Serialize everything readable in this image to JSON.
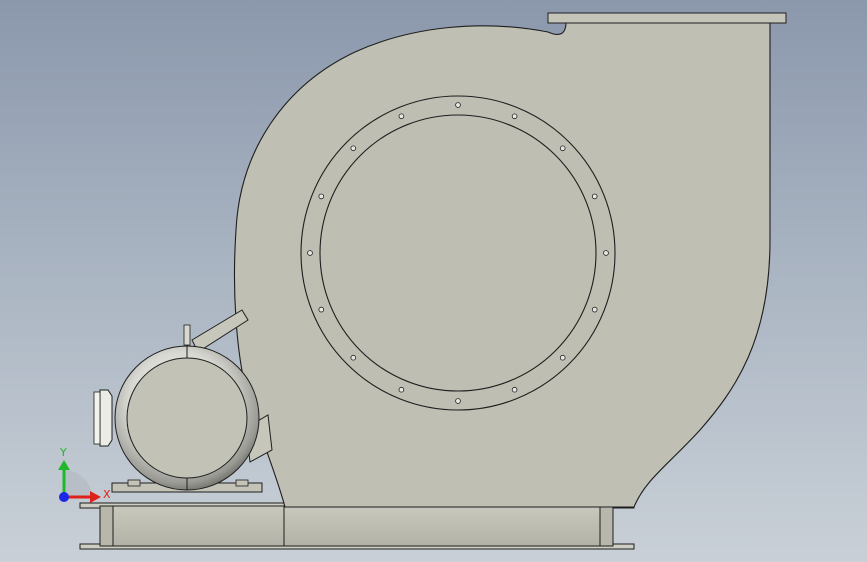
{
  "viewport": {
    "background_top": "#8b98ac",
    "background_bottom": "#c9d0d7"
  },
  "model": {
    "body_fill": "#c0bfb4",
    "edge_color": "#1e1e1e",
    "bolt_hole_count": 16
  },
  "triad": {
    "x_label": "X",
    "y_label": "Y",
    "x_color": "#e0201a",
    "y_color": "#1fb82a",
    "z_color": "#1a28e6"
  }
}
